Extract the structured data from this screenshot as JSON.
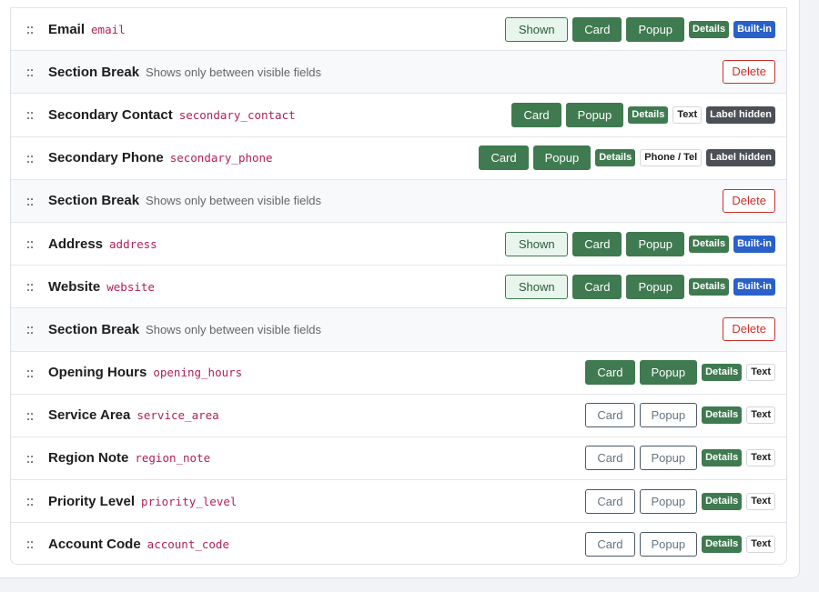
{
  "icons": {
    "drag_handle": "::"
  },
  "rows": [
    {
      "type": "field",
      "name": "Email",
      "key": "email",
      "actions": [
        {
          "kind": "btn-shown",
          "label": "Shown"
        },
        {
          "kind": "btn-green",
          "label": "Card"
        },
        {
          "kind": "btn-green",
          "label": "Popup"
        },
        {
          "kind": "b-details",
          "label": "Details"
        },
        {
          "kind": "b-builtin",
          "label": "Built-in"
        }
      ]
    },
    {
      "type": "break",
      "name": "Section Break",
      "hint": "Shows only between visible fields",
      "actions": [
        {
          "kind": "btn-delete",
          "label": "Delete"
        }
      ]
    },
    {
      "type": "field",
      "name": "Secondary Contact",
      "key": "secondary_contact",
      "actions": [
        {
          "kind": "btn-green",
          "label": "Card"
        },
        {
          "kind": "btn-green",
          "label": "Popup"
        },
        {
          "kind": "b-details",
          "label": "Details"
        },
        {
          "kind": "b-text",
          "label": "Text"
        },
        {
          "kind": "b-hidden",
          "label": "Label hidden"
        }
      ]
    },
    {
      "type": "field",
      "name": "Secondary Phone",
      "key": "secondary_phone",
      "actions": [
        {
          "kind": "btn-green",
          "label": "Card"
        },
        {
          "kind": "btn-green",
          "label": "Popup"
        },
        {
          "kind": "b-details",
          "label": "Details"
        },
        {
          "kind": "b-text",
          "label": "Phone / Tel"
        },
        {
          "kind": "b-hidden",
          "label": "Label hidden"
        }
      ]
    },
    {
      "type": "break",
      "name": "Section Break",
      "hint": "Shows only between visible fields",
      "actions": [
        {
          "kind": "btn-delete",
          "label": "Delete"
        }
      ]
    },
    {
      "type": "field",
      "name": "Address",
      "key": "address",
      "actions": [
        {
          "kind": "btn-shown",
          "label": "Shown"
        },
        {
          "kind": "btn-green",
          "label": "Card"
        },
        {
          "kind": "btn-green",
          "label": "Popup"
        },
        {
          "kind": "b-details",
          "label": "Details"
        },
        {
          "kind": "b-builtin",
          "label": "Built-in"
        }
      ]
    },
    {
      "type": "field",
      "name": "Website",
      "key": "website",
      "actions": [
        {
          "kind": "btn-shown",
          "label": "Shown"
        },
        {
          "kind": "btn-green",
          "label": "Card"
        },
        {
          "kind": "btn-green",
          "label": "Popup"
        },
        {
          "kind": "b-details",
          "label": "Details"
        },
        {
          "kind": "b-builtin",
          "label": "Built-in"
        }
      ]
    },
    {
      "type": "break",
      "name": "Section Break",
      "hint": "Shows only between visible fields",
      "actions": [
        {
          "kind": "btn-delete",
          "label": "Delete"
        }
      ]
    },
    {
      "type": "field",
      "name": "Opening Hours",
      "key": "opening_hours",
      "actions": [
        {
          "kind": "btn-green",
          "label": "Card"
        },
        {
          "kind": "btn-green",
          "label": "Popup"
        },
        {
          "kind": "b-details",
          "label": "Details"
        },
        {
          "kind": "b-text",
          "label": "Text"
        }
      ]
    },
    {
      "type": "field",
      "name": "Service Area",
      "key": "service_area",
      "actions": [
        {
          "kind": "btn-outline",
          "label": "Card"
        },
        {
          "kind": "btn-outline",
          "label": "Popup"
        },
        {
          "kind": "b-details",
          "label": "Details"
        },
        {
          "kind": "b-text",
          "label": "Text"
        }
      ]
    },
    {
      "type": "field",
      "name": "Region Note",
      "key": "region_note",
      "actions": [
        {
          "kind": "btn-outline",
          "label": "Card"
        },
        {
          "kind": "btn-outline",
          "label": "Popup"
        },
        {
          "kind": "b-details",
          "label": "Details"
        },
        {
          "kind": "b-text",
          "label": "Text"
        }
      ]
    },
    {
      "type": "field",
      "name": "Priority Level",
      "key": "priority_level",
      "actions": [
        {
          "kind": "btn-outline",
          "label": "Card"
        },
        {
          "kind": "btn-outline",
          "label": "Popup"
        },
        {
          "kind": "b-details",
          "label": "Details"
        },
        {
          "kind": "b-text",
          "label": "Text"
        }
      ]
    },
    {
      "type": "field",
      "name": "Account Code",
      "key": "account_code",
      "actions": [
        {
          "kind": "btn-outline",
          "label": "Card"
        },
        {
          "kind": "btn-outline",
          "label": "Popup"
        },
        {
          "kind": "b-details",
          "label": "Details"
        },
        {
          "kind": "b-text",
          "label": "Text"
        }
      ]
    }
  ]
}
